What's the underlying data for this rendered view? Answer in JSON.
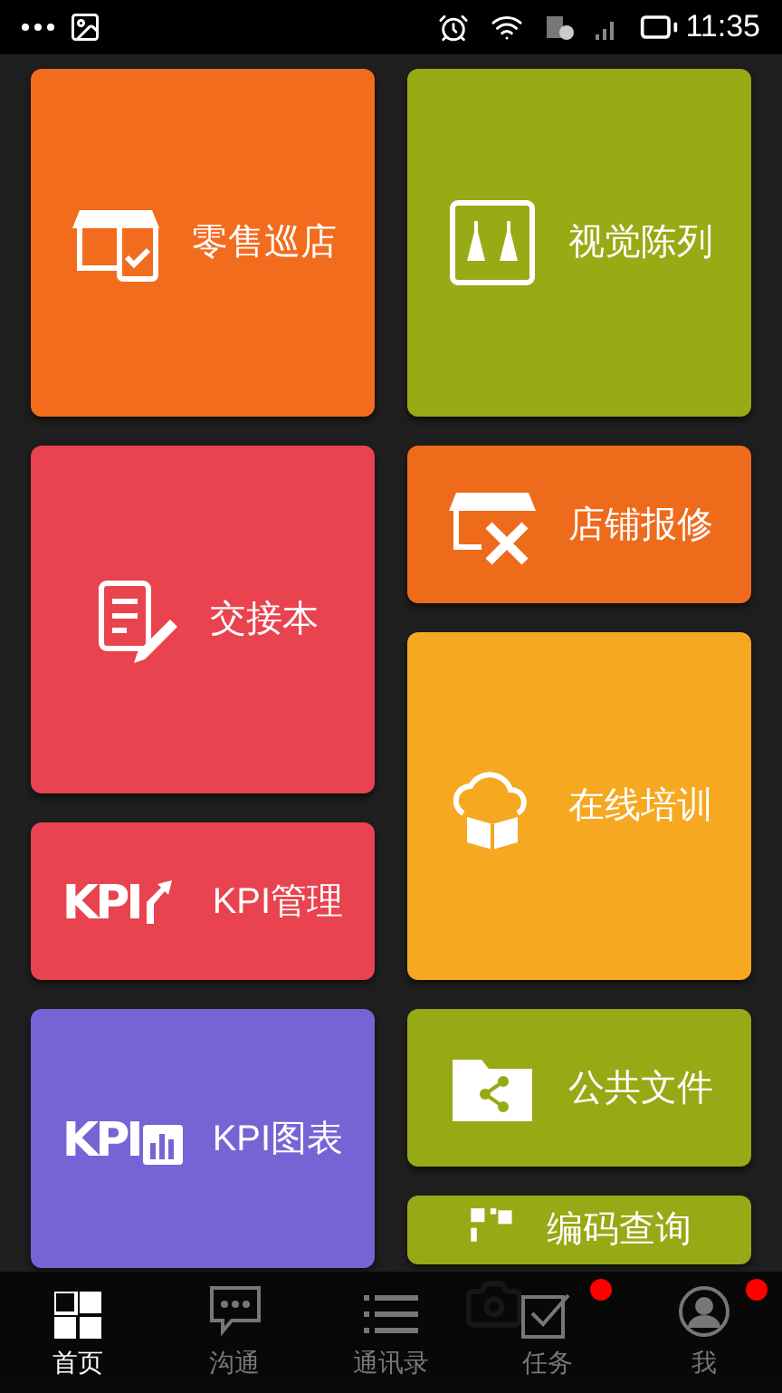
{
  "status_bar": {
    "time": "11:35"
  },
  "left_column": [
    {
      "label": "零售巡店",
      "color": "#f26c1e"
    },
    {
      "label": "交接本",
      "color": "#e8434f"
    },
    {
      "label": "KPI管理",
      "color": "#e8434f",
      "icon_text": "KPI"
    },
    {
      "label": "KPI图表",
      "color": "#7565d4",
      "icon_text": "KPI"
    }
  ],
  "right_column": [
    {
      "label": "视觉陈列",
      "color": "#98aa14"
    },
    {
      "label": "店铺报修",
      "color": "#ef6b1c"
    },
    {
      "label": "在线培训",
      "color": "#f6a821"
    },
    {
      "label": "公共文件",
      "color": "#97a914"
    },
    {
      "label": "编码查询",
      "color": "#97a914"
    }
  ],
  "tab_bar": [
    {
      "label": "首页",
      "selected": true,
      "badge": false
    },
    {
      "label": "沟通",
      "selected": false,
      "badge": false
    },
    {
      "label": "通讯录",
      "selected": false,
      "badge": false
    },
    {
      "label": "任务",
      "selected": false,
      "badge": true
    },
    {
      "label": "我",
      "selected": false,
      "badge": true
    }
  ]
}
